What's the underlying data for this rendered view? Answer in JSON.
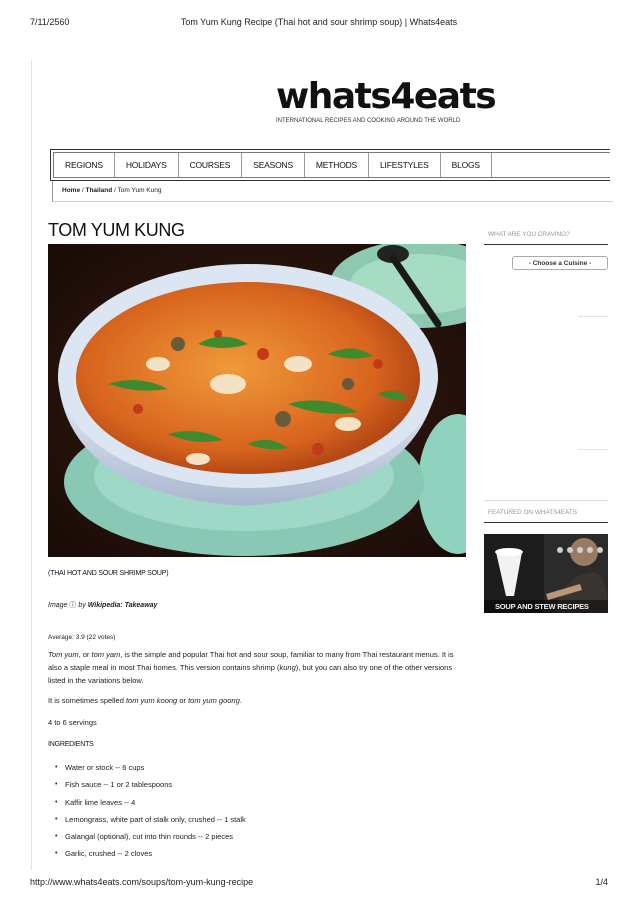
{
  "print": {
    "date": "7/11/2560",
    "doc_title": "Tom Yum Kung Recipe (Thai hot and sour shrimp soup) | Whats4eats",
    "url": "http://www.whats4eats.com/soups/tom-yum-kung-recipe",
    "page": "1/4"
  },
  "site": {
    "logo": "whats4eats",
    "tagline": "INTERNATIONAL RECIPES AND COOKING AROUND THE WORLD"
  },
  "nav": {
    "items": [
      "REGIONS",
      "HOLIDAYS",
      "COURSES",
      "SEASONS",
      "METHODS",
      "LIFESTYLES",
      "BLOGS"
    ]
  },
  "breadcrumb": {
    "home": "Home",
    "sep1": " / ",
    "region": "Thailand",
    "sep2": " / ",
    "current": "Tom Yum Kung"
  },
  "article": {
    "title": "TOM YUM KUNG",
    "subtitle": "(THAI HOT AND SOUR SHRIMP SOUP)",
    "credit_prefix": "Image",
    "credit_by": " by ",
    "credit_source": "Wikipedia: Takeaway",
    "rating": "Average: 3.9  (22 votes)",
    "p1_em1": "Tom yum",
    "p1_a": ", or ",
    "p1_em2": "tom yam",
    "p1_b": ", is the simple and popular Thai hot and sour soup, familiar to many from Thai restaurant menus. It is also a staple meal in most Thai homes. This version contains shrimp (",
    "p1_em3": "kung",
    "p1_c": "), but you can also try one of the other versions listed in the variations below.",
    "p2_a": "It is sometimes spelled ",
    "p2_em1": "tom yum koong",
    "p2_b": " or ",
    "p2_em2": "tom yum goong",
    "p2_c": ".",
    "servings": "4 to 6 servings",
    "ingredients_heading": "INGREDIENTS",
    "ingredients": [
      "Water or stock -- 6 cups",
      "Fish sauce -- 1 or 2 tablespoons",
      "Kaffir lime leaves -- 4",
      "Lemongrass, white part of stalk only, crushed -- 1 stalk",
      "Galangal (optional), cut into thin rounds -- 2 pieces",
      "Garlic, crushed -- 2 cloves"
    ]
  },
  "sidebar": {
    "craving_heading": "WHAT ARE YOU CRAVING?",
    "cuisine_select": "- Choose a Cuisine -",
    "featured_heading": "FEATURED ON WHATS4EATS",
    "featured_label": "SOUP AND STEW RECIPES"
  }
}
